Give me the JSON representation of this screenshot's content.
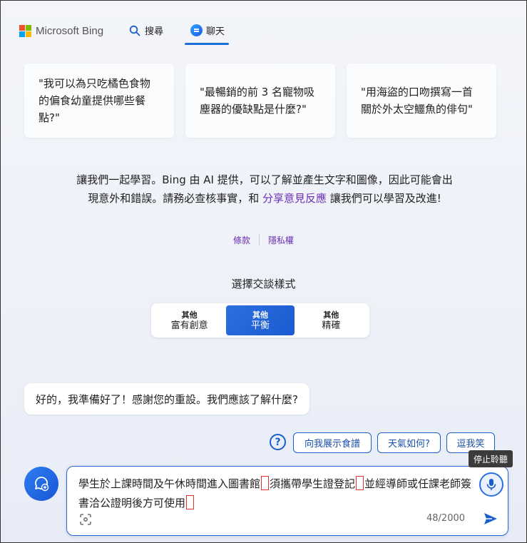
{
  "header": {
    "brand": "Microsoft Bing",
    "tabs": [
      {
        "label": "搜尋",
        "icon": "search-icon"
      },
      {
        "label": "聊天",
        "icon": "chat-icon",
        "active": true
      }
    ]
  },
  "suggestions": [
    "\"我可以為只吃橘色食物的偏食幼童提供哪些餐點?\"",
    "\"最暢銷的前 3 名寵物吸塵器的優缺點是什麼?\"",
    "\"用海盜的口吻撰寫一首關於外太空鱷魚的俳句\""
  ],
  "disclaimer": {
    "before": "讓我們一起學習。Bing 由 AI 提供，可以了解並產生文字和圖像，因此可能會出現意外和錯誤。請務必查核事實，和 ",
    "link": "分享意見反應",
    "after": " 讓我們可以學習及改進!"
  },
  "legal_links": {
    "terms": "條款",
    "privacy": "隱私權"
  },
  "style_selector": {
    "title": "選擇交談樣式",
    "options": [
      {
        "small": "其他",
        "label": "富有創意",
        "active": false
      },
      {
        "small": "其他",
        "label": "平衡",
        "active": true
      },
      {
        "small": "其他",
        "label": "精確",
        "active": false
      }
    ]
  },
  "bot_message": "好的，我準備好了！感謝您的重設。我們應該了解什麼?",
  "quick_replies": [
    "向我展示食譜",
    "天氣如何?",
    "逗我笑"
  ],
  "tooltip": "停止聆聽",
  "input": {
    "seg1": "學生於上課時間及午休時間進入圖書館",
    "seg2": "須攜帶學生證登記",
    "seg3": "並經導師或任課老師簽書洽公證明後方可使用",
    "counter": "48/2000"
  },
  "colors": {
    "accent": "#1a6fd8",
    "link": "#6b2fb3",
    "annotation_marks": "#e03030"
  }
}
